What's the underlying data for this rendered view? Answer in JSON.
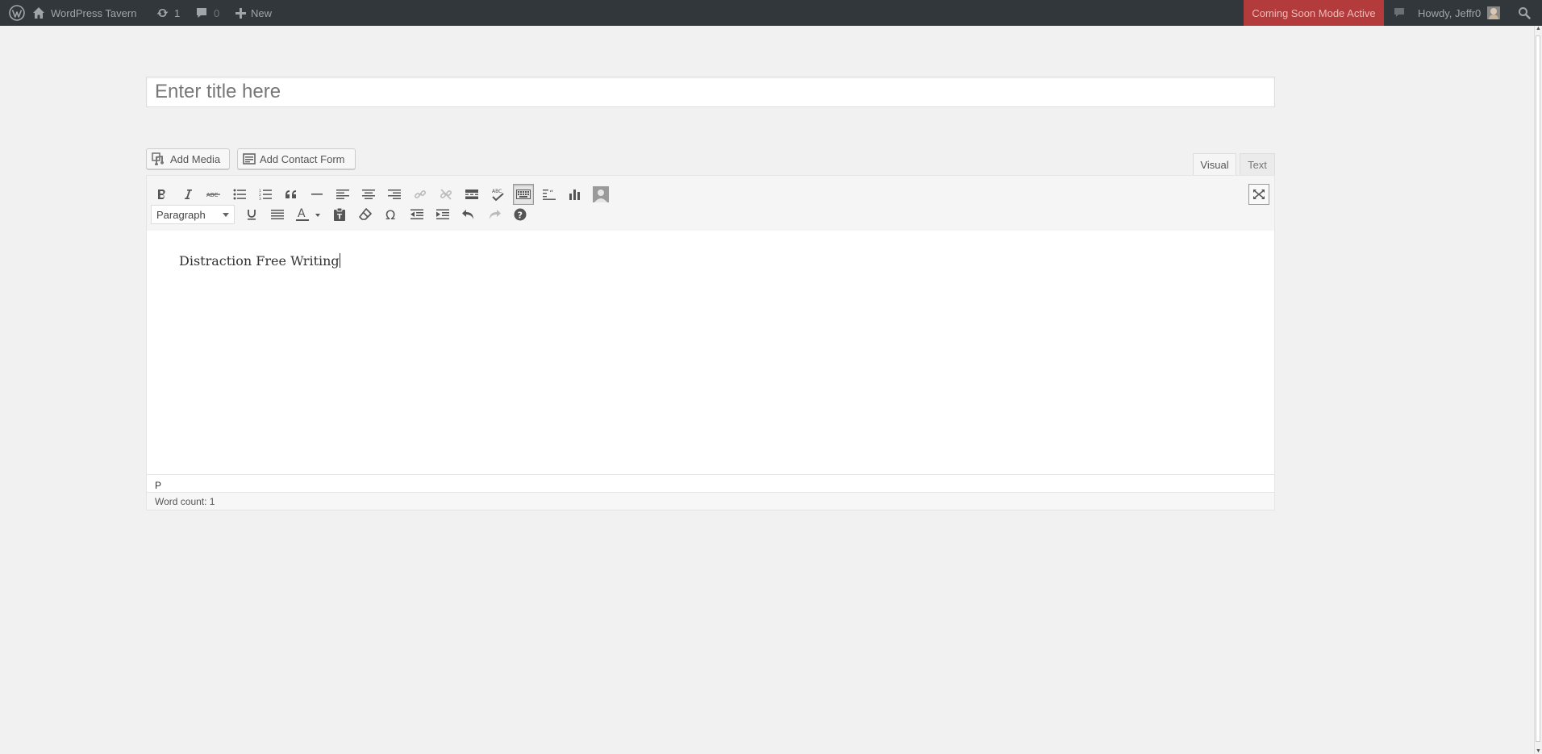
{
  "admin_bar": {
    "site_name": "WordPress Tavern",
    "updates_count": "1",
    "comments_count": "0",
    "new_label": "New",
    "coming_soon_label": "Coming Soon Mode Active",
    "howdy_label": "Howdy, Jeffr0"
  },
  "post": {
    "title_placeholder": "Enter title here",
    "title_value": ""
  },
  "media_buttons": {
    "add_media": "Add Media",
    "add_contact_form": "Add Contact Form"
  },
  "editor_tabs": {
    "visual": "Visual",
    "text": "Text",
    "active": "visual"
  },
  "toolbar": {
    "format_selected": "Paragraph"
  },
  "content": {
    "text": "Distraction Free Writing"
  },
  "path": "P",
  "status": {
    "word_count": "Word count: 1"
  },
  "colors": {
    "admin_bar_bg": "#32373c",
    "coming_soon_bg": "#b33b3b",
    "page_bg": "#f1f1f1"
  }
}
